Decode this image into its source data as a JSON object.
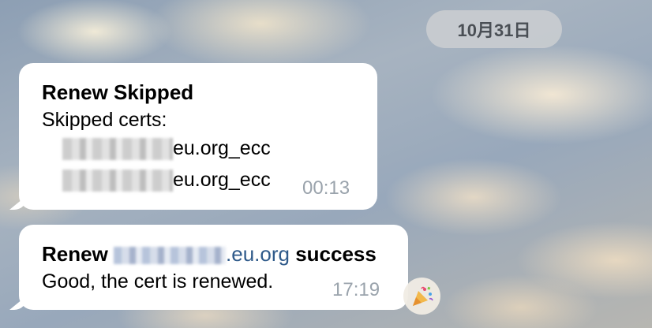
{
  "date_divider": "10月31日",
  "messages": [
    {
      "title": "Renew Skipped",
      "subtitle": "Skipped certs:",
      "cert1_suffix": "eu.org_ecc",
      "cert2_suffix": "eu.org_ecc",
      "time": "00:13"
    },
    {
      "title_prefix": "Renew ",
      "title_domain": ".eu.org",
      "title_suffix": " success",
      "body": "Good, the cert is renewed.",
      "time": "17:19",
      "reaction_icon": "party-popper-icon"
    }
  ]
}
